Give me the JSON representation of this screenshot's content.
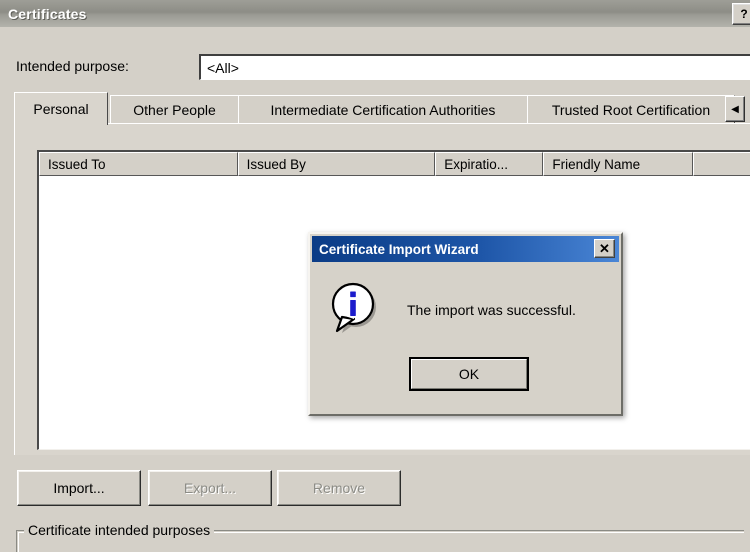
{
  "window": {
    "title": "Certificates",
    "help_button": "?"
  },
  "purpose": {
    "label": "Intended purpose:",
    "value": "<All>"
  },
  "tabs": [
    {
      "label": "Personal",
      "active": true
    },
    {
      "label": "Other People",
      "active": false
    },
    {
      "label": "Intermediate Certification Authorities",
      "active": false
    },
    {
      "label": "Trusted Root Certification",
      "active": false
    }
  ],
  "tab_scroll": {
    "left_arrow": "◀"
  },
  "list": {
    "columns": [
      "Issued To",
      "Issued By",
      "Expiratio...",
      "Friendly Name",
      ""
    ],
    "rows": []
  },
  "actions": {
    "import": "Import...",
    "export": "Export...",
    "remove": "Remove"
  },
  "groupbox": {
    "label": "Certificate intended purposes"
  },
  "dialog": {
    "title": "Certificate Import Wizard",
    "close_label": "✕",
    "icon": "information-icon",
    "message": "The import was successful.",
    "ok_label": "OK"
  },
  "colors": {
    "window_face": "#d4d0c8",
    "dialog_title_start": "#0b3c86",
    "dialog_title_end": "#4a86d6",
    "info_icon_blue": "#1c1ccc",
    "titlebar_gray": "#9e9e97"
  }
}
